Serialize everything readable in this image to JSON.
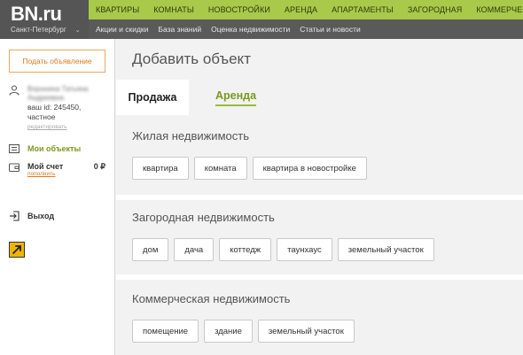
{
  "brand": {
    "logo": "BN.ru",
    "city": "Санкт-Петербург"
  },
  "topnav": [
    "КВАРТИРЫ",
    "КОМНАТЫ",
    "НОВОСТРОЙКИ",
    "АРЕНДА",
    "АПАРТАМЕНТЫ",
    "ЗАГОРОДНАЯ",
    "КОММЕРЧЕСКАЯ"
  ],
  "subnav": [
    "Акции и скидки",
    "База знаний",
    "Оценка недвижимости",
    "Статьи и новости"
  ],
  "sidebar": {
    "post_button": "Подать объявление",
    "user": {
      "name_line1": "Воронина Татьяна",
      "name_line2": "Андреевна",
      "id_line": "ваш id: 245450,",
      "type": "частное",
      "edit_link": "редактировать"
    },
    "my_objects": "Мои объекты",
    "account_label": "Мой счет",
    "balance": "0 ₽",
    "topup_link": "пополнить",
    "logout": "Выход"
  },
  "main": {
    "title": "Добавить объект",
    "tabs": [
      "Продажа",
      "Аренда"
    ],
    "sections": [
      {
        "title": "Жилая недвижимость",
        "chips": [
          "квартира",
          "комната",
          "квартира в новостройке"
        ]
      },
      {
        "title": "Загородная недвижимость",
        "chips": [
          "дом",
          "дача",
          "коттедж",
          "таунхаус",
          "земельный участок"
        ]
      },
      {
        "title": "Коммерческая недвижимость",
        "chips": [
          "помещение",
          "здание",
          "земельный участок"
        ]
      }
    ]
  },
  "colors": {
    "header_bg": "#5a5a5a",
    "nav_green": "#a9c94a",
    "accent_green": "#7a9a1e",
    "accent_orange": "#e07a1b"
  }
}
